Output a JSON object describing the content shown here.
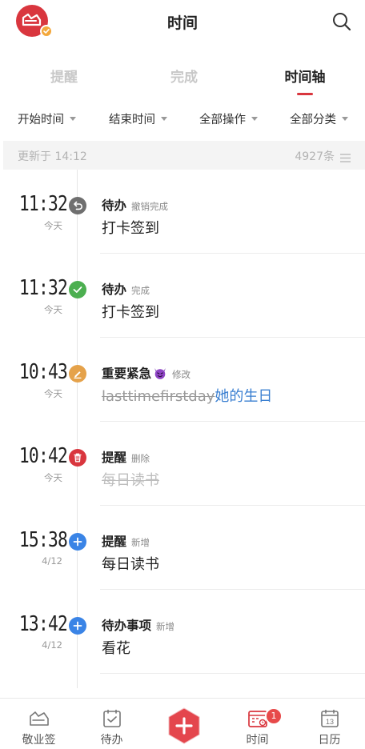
{
  "header": {
    "title": "时间",
    "logo_icon": "app-logo-icon",
    "search_icon": "search-icon"
  },
  "tabs": [
    {
      "label": "提醒",
      "active": false
    },
    {
      "label": "完成",
      "active": false
    },
    {
      "label": "时间轴",
      "active": true
    }
  ],
  "filters": [
    {
      "label": "开始时间"
    },
    {
      "label": "结束时间"
    },
    {
      "label": "全部操作"
    },
    {
      "label": "全部分类"
    }
  ],
  "status": {
    "updated": "更新于 14:12",
    "count": "4927条"
  },
  "entries": [
    {
      "time": "11:32",
      "date": "今天",
      "category": "待办",
      "operation": "撤销完成",
      "content": "打卡签到",
      "icon": "undo-icon",
      "icon_color": "#6f6f6f"
    },
    {
      "time": "11:32",
      "date": "今天",
      "category": "待办",
      "operation": "完成",
      "content": "打卡签到",
      "icon": "check-icon",
      "icon_color": "#4caf50"
    },
    {
      "time": "10:43",
      "date": "今天",
      "category": "重要紧急",
      "operation": "修改",
      "old_content": "lasttimefirstday",
      "new_content": "她的生日",
      "icon": "edit-icon",
      "icon_color": "#e5a24a"
    },
    {
      "time": "10:42",
      "date": "今天",
      "category": "提醒",
      "operation": "删除",
      "content": "每日读书",
      "icon": "trash-icon",
      "icon_color": "#d9363e"
    },
    {
      "time": "15:38",
      "date": "4/12",
      "category": "提醒",
      "operation": "新增",
      "content": "每日读书",
      "icon": "plus-icon",
      "icon_color": "#3a84e6"
    },
    {
      "time": "13:42",
      "date": "4/12",
      "category": "待办事项",
      "operation": "新增",
      "content": "看花",
      "icon": "plus-icon",
      "icon_color": "#3a84e6"
    }
  ],
  "bottom_nav": [
    {
      "label": "敬业签",
      "icon": "notes-icon",
      "active": false
    },
    {
      "label": "待办",
      "icon": "todo-check-icon",
      "active": false
    },
    {
      "label": "",
      "icon": "add-icon",
      "active": false
    },
    {
      "label": "时间",
      "icon": "timeline-calendar-icon",
      "active": true,
      "badge": "1"
    },
    {
      "label": "日历",
      "icon": "calendar-icon",
      "active": false,
      "calendar_day": "13"
    }
  ],
  "colors": {
    "accent": "#d9363e",
    "link_blue": "#3a7fd1"
  }
}
